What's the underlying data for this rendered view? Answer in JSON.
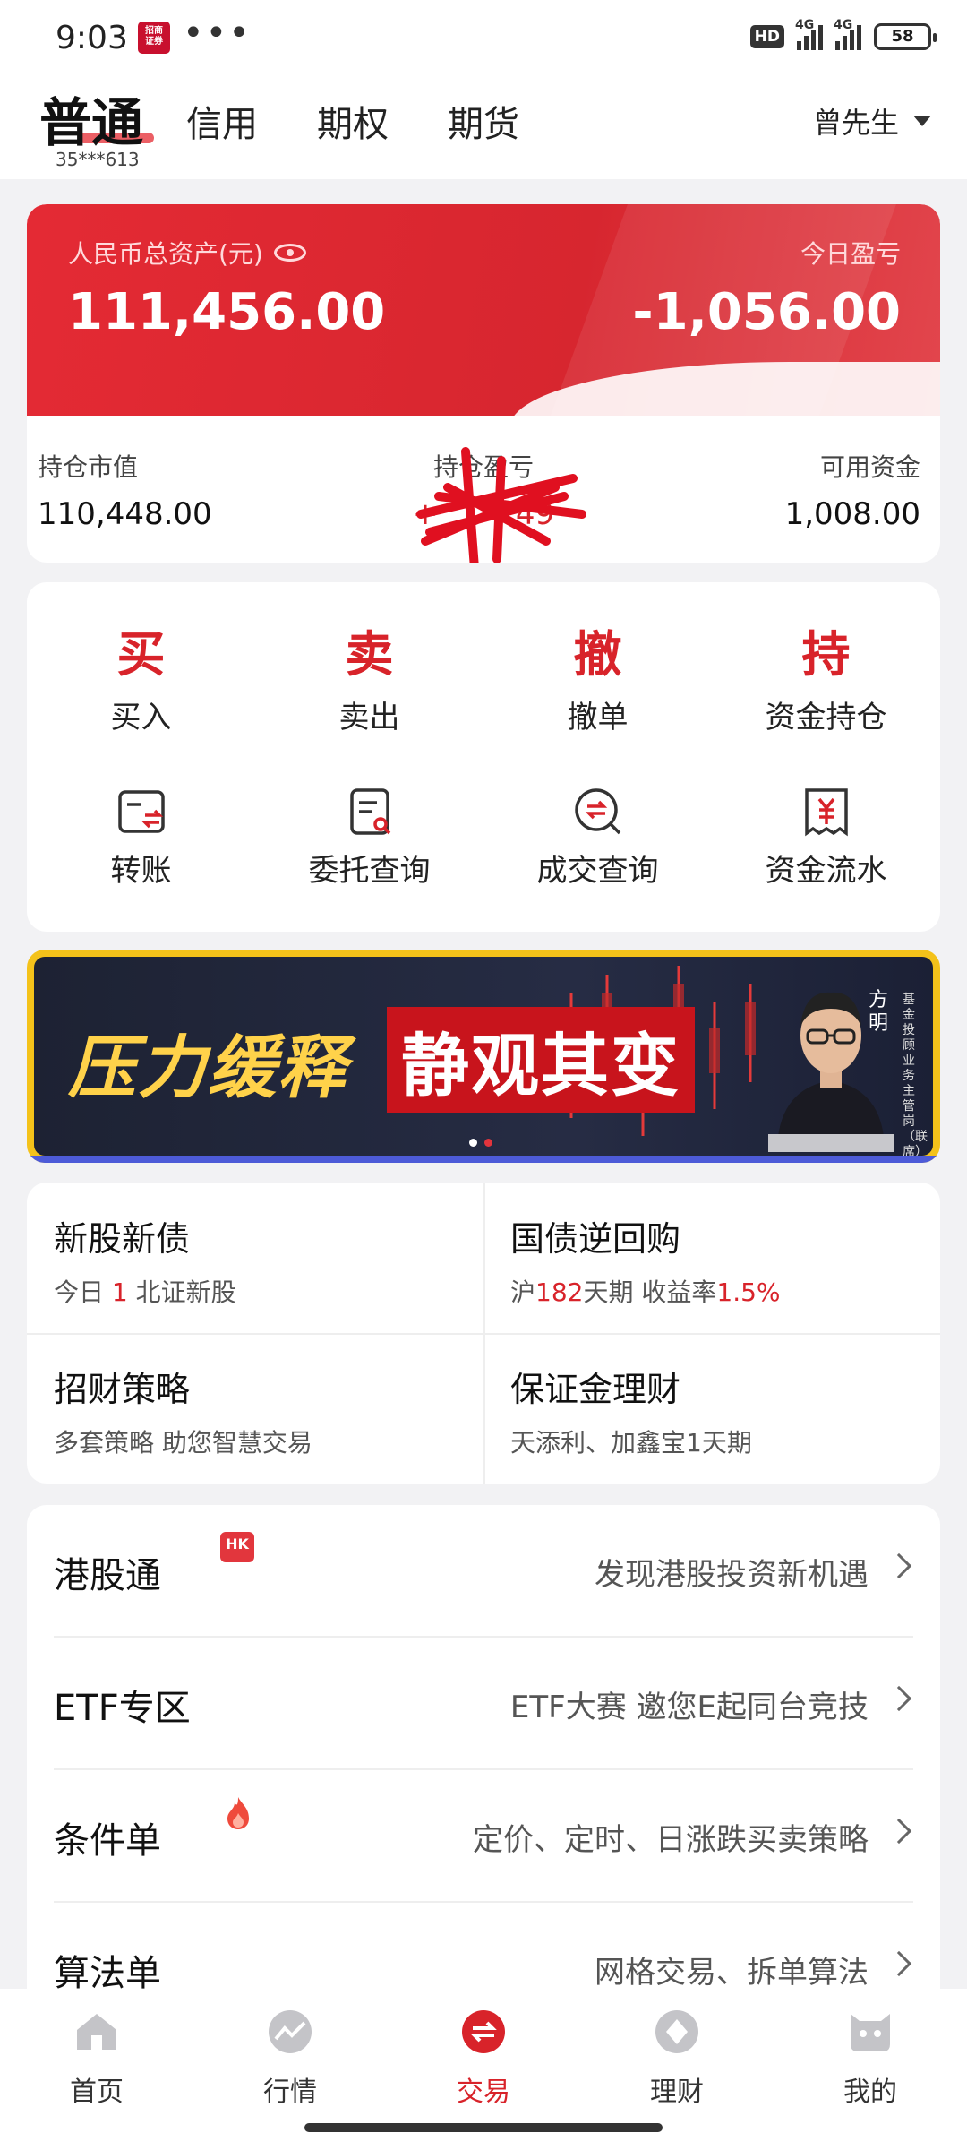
{
  "status_bar": {
    "time": "9:03",
    "app_badge": "招商证券",
    "more": "•••",
    "hd": "HD",
    "net1": "4G",
    "net2": "4G",
    "battery": "58"
  },
  "header": {
    "active_tab": "普通",
    "account": "35***613",
    "tabs": [
      "信用",
      "期权",
      "期货"
    ],
    "user": "曾先生"
  },
  "assets": {
    "total_label": "人民币总资产(元)",
    "total_value": "111,456.00",
    "today_pl_label": "今日盈亏",
    "today_pl_value": "-1,056.00",
    "position_value_label": "持仓市值",
    "position_value": "110,448.00",
    "position_pl_label": "持仓盈亏",
    "position_pl_value": "+",
    "position_pl_tail": "49",
    "available_label": "可用资金",
    "available_value": "1,008.00"
  },
  "actions": [
    {
      "glyph": "买",
      "label": "买入"
    },
    {
      "glyph": "卖",
      "label": "卖出"
    },
    {
      "glyph": "撤",
      "label": "撤单"
    },
    {
      "glyph": "持",
      "label": "资金持仓"
    }
  ],
  "tools": [
    {
      "icon": "transfer-icon",
      "label": "转账"
    },
    {
      "icon": "order-query-icon",
      "label": "委托查询"
    },
    {
      "icon": "deal-query-icon",
      "label": "成交查询"
    },
    {
      "icon": "fund-flow-icon",
      "label": "资金流水"
    }
  ],
  "banner": {
    "title1": "压力缓释",
    "title2": "静观其变",
    "name": "方明",
    "role": "基金投顾业务主管岗（联席）"
  },
  "features": [
    {
      "title": "新股新债",
      "sub_pre": "今日 ",
      "sub_red": "1",
      "sub_post": " 北证新股"
    },
    {
      "title": "国债逆回购",
      "sub_pre": "沪",
      "sub_red": "182",
      "sub_mid": "天期 收益率",
      "sub_red2": "1.5%"
    },
    {
      "title": "招财策略",
      "sub": "多套策略 助您智慧交易"
    },
    {
      "title": "保证金理财",
      "sub": "天添利、加鑫宝1天期"
    }
  ],
  "list": [
    {
      "label": "港股通",
      "badge": "HK",
      "desc": "发现港股投资新机遇"
    },
    {
      "label": "ETF专区",
      "desc": "ETF大赛 邀您E起同台竞技"
    },
    {
      "label": "条件单",
      "desc": "定价、定时、日涨跌买卖策略"
    },
    {
      "label": "算法单",
      "desc": "网格交易、拆单算法"
    }
  ],
  "nav": [
    {
      "label": "首页",
      "icon": "home-icon"
    },
    {
      "label": "行情",
      "icon": "market-icon"
    },
    {
      "label": "交易",
      "icon": "trade-icon",
      "active": true
    },
    {
      "label": "理财",
      "icon": "wealth-icon"
    },
    {
      "label": "我的",
      "icon": "profile-icon"
    }
  ],
  "colors": {
    "accent": "#d8232a",
    "card_red": "#e42a34"
  }
}
